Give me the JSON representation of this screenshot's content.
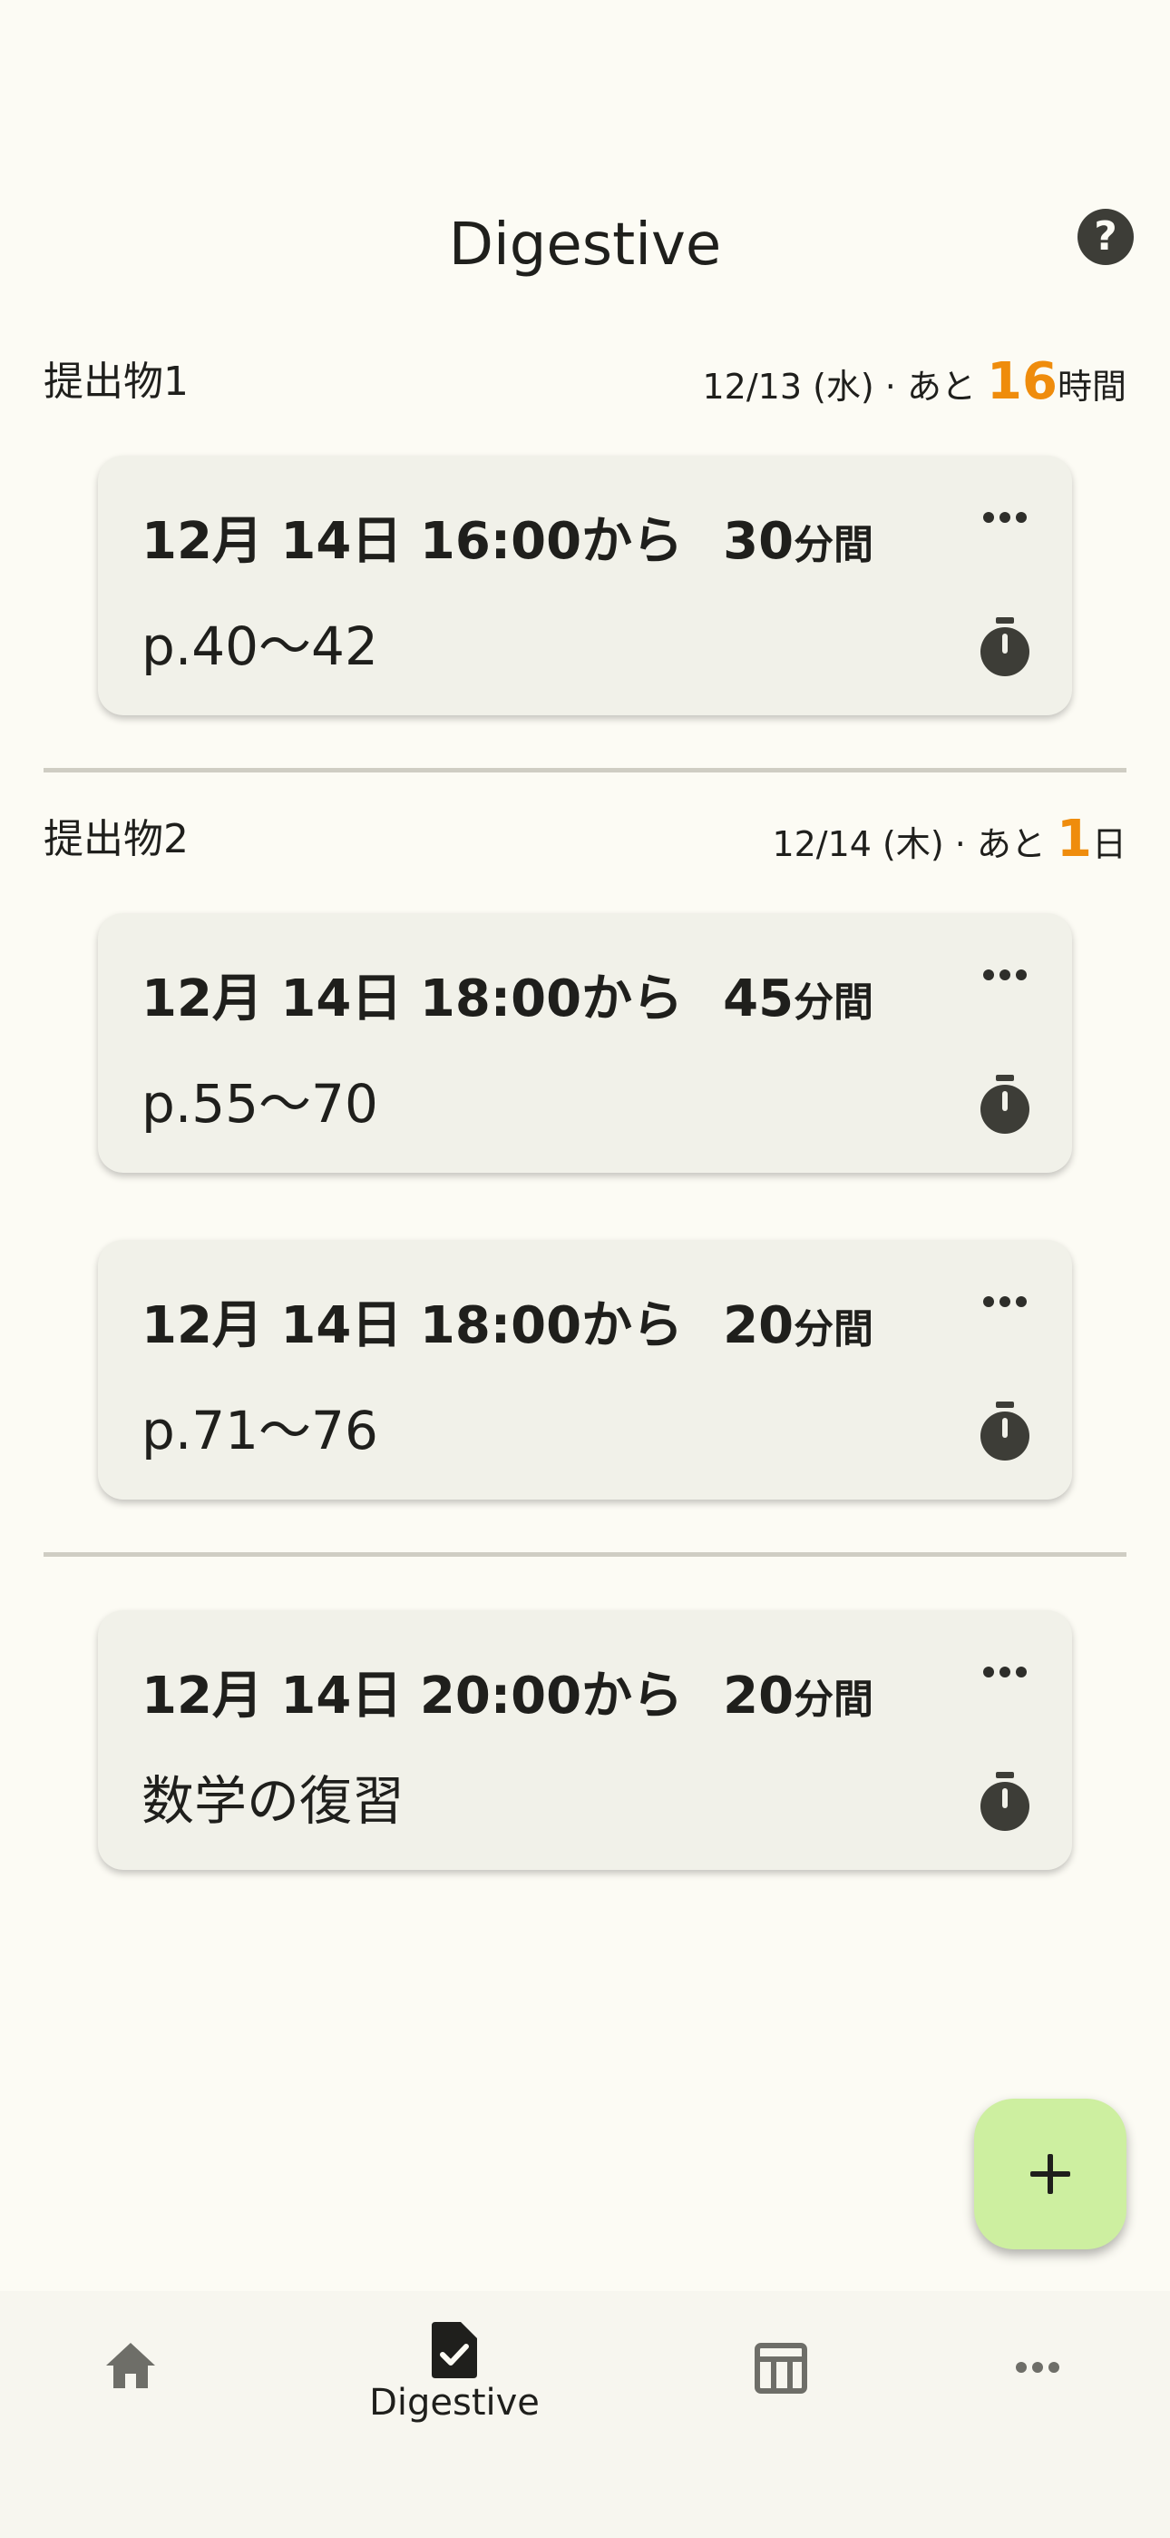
{
  "header": {
    "title": "Digestive",
    "help_icon": "help-circle-icon",
    "help_glyph": "?"
  },
  "sections": [
    {
      "name": "提出物1",
      "deadline_prefix": "12/13 (水) · あと ",
      "deadline_num": "16",
      "deadline_unit": "時間",
      "tasks": [
        {
          "date": "12月 14日",
          "time": "16:00から",
          "duration": "30",
          "duration_unit": "分間",
          "title": "p.40〜42"
        }
      ]
    },
    {
      "name": "提出物2",
      "deadline_prefix": "12/14 (木) · あと ",
      "deadline_num": "1",
      "deadline_unit": "日",
      "tasks": [
        {
          "date": "12月 14日",
          "time": "18:00から",
          "duration": "45",
          "duration_unit": "分間",
          "title": "p.55〜70"
        },
        {
          "date": "12月 14日",
          "time": "18:00から",
          "duration": "20",
          "duration_unit": "分間",
          "title": "p.71〜76"
        }
      ]
    }
  ],
  "other_tasks": [
    {
      "date": "12月 14日",
      "time": "20:00から",
      "duration": "20",
      "duration_unit": "分間",
      "title": "数学の復習"
    }
  ],
  "fab": {
    "icon": "plus-icon"
  },
  "bottom_nav": {
    "items": [
      {
        "icon": "home-icon",
        "label": ""
      },
      {
        "icon": "assignment-check-icon",
        "label": "Digestive"
      },
      {
        "icon": "table-icon",
        "label": ""
      },
      {
        "icon": "more-horizontal-icon",
        "label": ""
      }
    ]
  },
  "colors": {
    "background": "#fcfbf4",
    "card": "#f1f1e9",
    "accent_orange": "#ef8c0c",
    "fab": "#cdefa0",
    "icon_dark": "#3d3d37"
  }
}
